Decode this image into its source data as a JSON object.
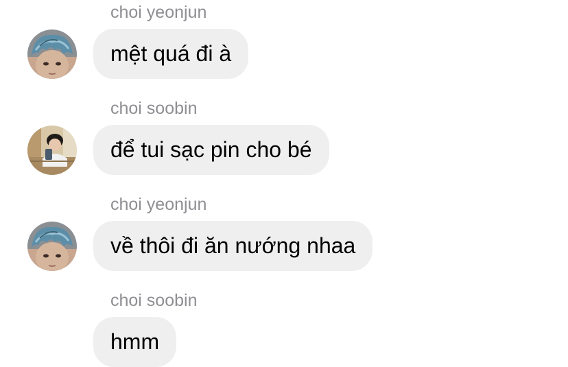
{
  "messages": [
    {
      "sender": "choi yeonjun",
      "text": "mệt quá đi à",
      "avatar": "avatar-yeonjun"
    },
    {
      "sender": "choi soobin",
      "text": "để tui sạc pin cho bé",
      "avatar": "avatar-soobin"
    },
    {
      "sender": "choi yeonjun",
      "text": "về thôi đi ăn nướng nhaa",
      "avatar": "avatar-yeonjun"
    },
    {
      "sender": "choi soobin",
      "text": "hmm",
      "avatar": "avatar-soobin"
    }
  ],
  "colors": {
    "bubble": "#efefef",
    "sender_name": "#8e8e93",
    "text": "#000000"
  }
}
